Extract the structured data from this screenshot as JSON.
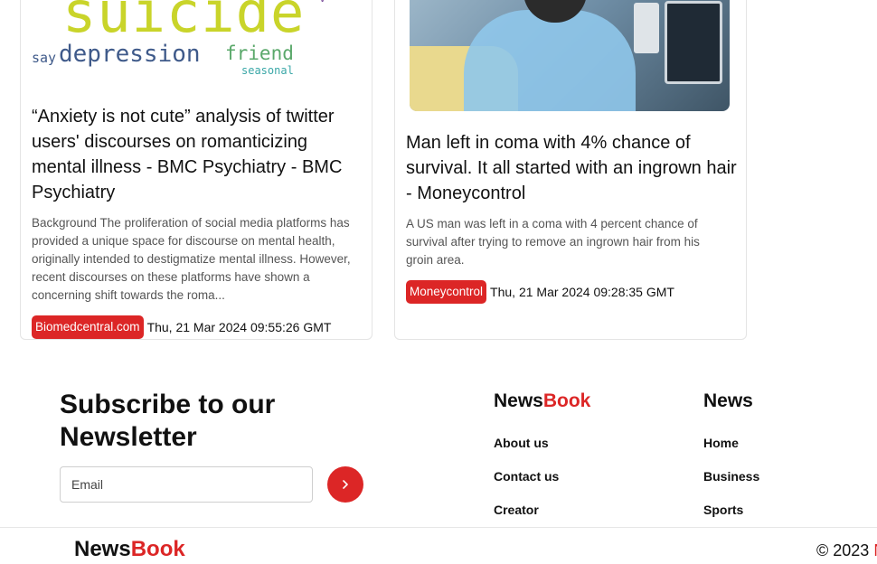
{
  "articles": [
    {
      "image_words": [
        "suicide",
        "say",
        "depression",
        "friend",
        "seasonal",
        "v"
      ],
      "title": "“Anxiety is not cute” analysis of twitter users' discourses on romanticizing mental illness - BMC Psychiatry - BMC Psychiatry",
      "description": "Background The proliferation of social media platforms has provided a unique space for discourse on mental health, originally intended to destigmatize mental illness. However, recent discourses on these platforms have shown a concerning shift towards the roma...",
      "source": "Biomedcentral.com",
      "date": "Thu, 21 Mar 2024 09:55:26 GMT"
    },
    {
      "title": "Man left in coma with 4% chance of survival. It all started with an ingrown hair - Moneycontrol",
      "description": "A US man was left in a coma with 4 percent chance of survival after trying to remove an ingrown hair from his groin area.",
      "source": "Moneycontrol",
      "date": "Thu, 21 Mar 2024 09:28:35 GMT"
    }
  ],
  "newsletter": {
    "heading": "Subscribe to our Newsletter",
    "email_placeholder": "Email",
    "submit_icon": "chevron-right-icon"
  },
  "brand": {
    "part1": "News",
    "part2": "Book"
  },
  "footer": {
    "company_links": [
      "About us",
      "Contact us",
      "Creator"
    ],
    "news_title": "News",
    "news_links": [
      "Home",
      "Business",
      "Sports"
    ]
  },
  "copyright": {
    "text": "© 2023",
    "accent": "N"
  },
  "colors": {
    "accent": "#dc2626",
    "text": "#111111",
    "muted": "#555555"
  }
}
